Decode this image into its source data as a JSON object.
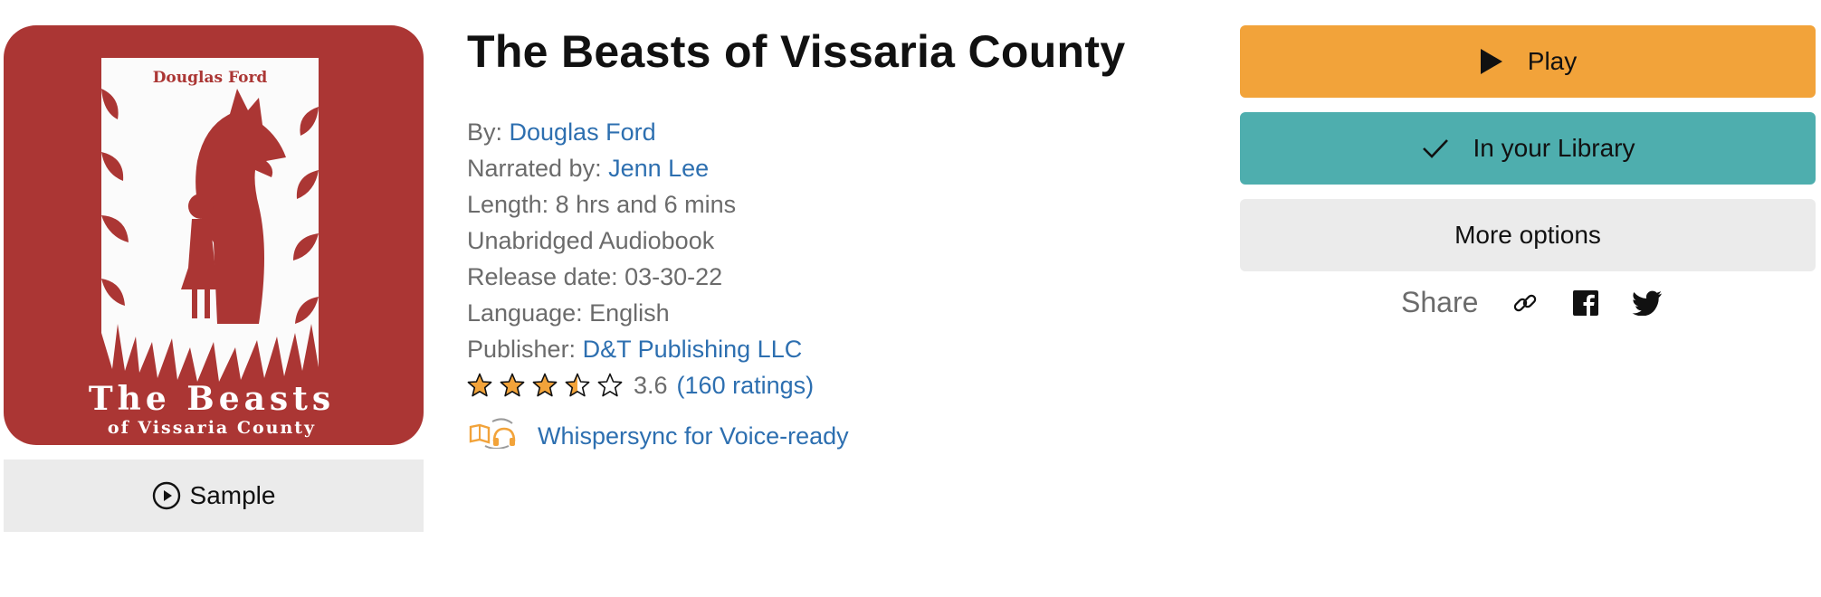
{
  "book": {
    "title": "The Beasts of Vissaria County",
    "cover": {
      "author_text": "Douglas Ford",
      "title_line1": "The Beasts",
      "title_line2": "of Vissaria County",
      "background_color": "#ab3634"
    }
  },
  "sample": {
    "label": "Sample",
    "icon": "play-circle-icon"
  },
  "details": {
    "by_label": "By: ",
    "author": "Douglas Ford",
    "narrated_label": "Narrated by: ",
    "narrator": "Jenn Lee",
    "length": "Length: 8 hrs and 6 mins",
    "format": "Unabridged Audiobook",
    "release_date": "Release date: 03-30-22",
    "language": "Language: English",
    "publisher_label": "Publisher: ",
    "publisher": "D&T Publishing LLC",
    "rating_value": "3.6",
    "rating_count": "(160 ratings)",
    "stars_filled": 3.5,
    "stars_total": 5
  },
  "whispersync": {
    "label": "Whispersync for Voice-ready",
    "icon": "book-headphones-icon"
  },
  "actions": {
    "play_label": "Play",
    "library_label": "In your Library",
    "more_label": "More options"
  },
  "share": {
    "label": "Share",
    "icons": [
      "link-icon",
      "facebook-icon",
      "twitter-icon"
    ]
  },
  "colors": {
    "play": "#f2a33a",
    "library": "#4eaeae",
    "more": "#ebebeb",
    "link": "#2d6fb0",
    "star": "#f2a33a"
  }
}
